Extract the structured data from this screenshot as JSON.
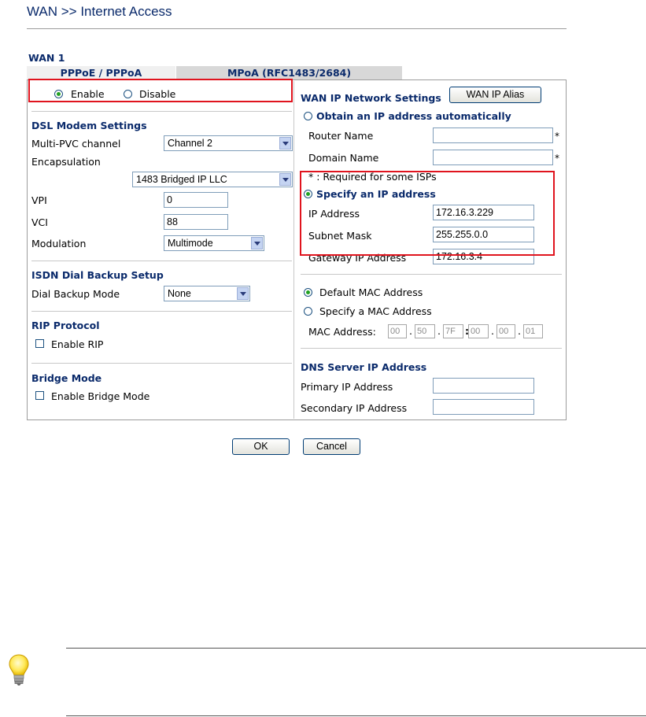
{
  "header": {
    "title": "WAN >> Internet Access"
  },
  "wan": {
    "label": "WAN 1"
  },
  "tabs": [
    {
      "label": "PPPoE / PPPoA"
    },
    {
      "label": "MPoA (RFC1483/2684)"
    }
  ],
  "enable_group": {
    "enable_label": "Enable",
    "disable_label": "Disable",
    "selected": "Enable"
  },
  "dsl": {
    "section_title": "DSL Modem Settings",
    "multi_pvc_label": "Multi-PVC channel",
    "multi_pvc_value": "Channel 2",
    "encapsulation_label": "Encapsulation",
    "encapsulation_value": "1483 Bridged IP LLC",
    "vpi_label": "VPI",
    "vpi_value": "0",
    "vci_label": "VCI",
    "vci_value": "88",
    "modulation_label": "Modulation",
    "modulation_value": "Multimode"
  },
  "isdn": {
    "section_title": "ISDN Dial Backup Setup",
    "mode_label": "Dial Backup Mode",
    "mode_value": "None"
  },
  "rip": {
    "section_title": "RIP Protocol",
    "enable_label": "Enable RIP"
  },
  "bridge": {
    "section_title": "Bridge Mode",
    "enable_label": "Enable Bridge Mode"
  },
  "wan_ip": {
    "section_title": "WAN IP Network Settings",
    "alias_button": "WAN IP Alias",
    "obtain_label": "Obtain an IP address automatically",
    "router_name_label": "Router Name",
    "router_name_value": "",
    "domain_name_label": "Domain Name",
    "domain_name_value": "",
    "required_note": "* : Required for some ISPs",
    "star": "*",
    "specify_label": "Specify an IP address",
    "ip_label": "IP Address",
    "ip_value": "172.16.3.229",
    "mask_label": "Subnet Mask",
    "mask_value": "255.255.0.0",
    "gateway_label": "Gateway IP Address",
    "gateway_value": "172.16.3.4"
  },
  "mac": {
    "default_label": "Default MAC Address",
    "specify_label": "Specify a MAC Address",
    "address_label": "MAC Address:",
    "octets": [
      "00",
      "50",
      "7F",
      "00",
      "00",
      "01"
    ],
    "separators": [
      ".",
      ".",
      ":",
      ".",
      "."
    ]
  },
  "dns": {
    "section_title": "DNS Server IP Address",
    "primary_label": "Primary IP Address",
    "primary_value": "",
    "secondary_label": "Secondary IP Address",
    "secondary_value": ""
  },
  "actions": {
    "ok_label": "OK",
    "cancel_label": "Cancel"
  },
  "colors": {
    "highlight": "#e0141e",
    "section_text": "#0a2a6b",
    "radio_dot": "#21a121"
  }
}
